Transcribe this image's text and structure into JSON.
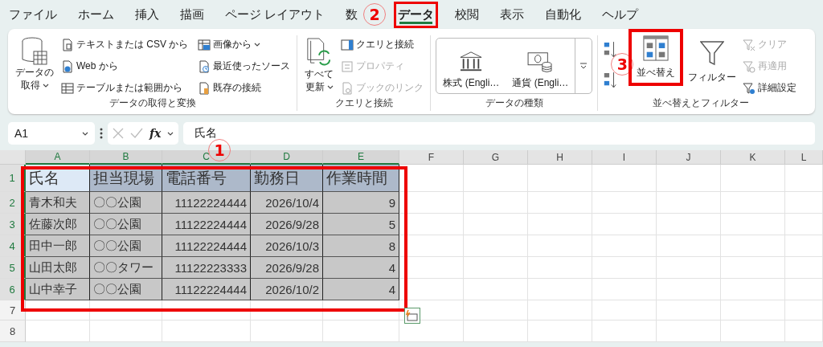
{
  "menu_tabs": [
    {
      "label": "ファイル",
      "selected": false,
      "highlighted": false
    },
    {
      "label": "ホーム",
      "selected": false,
      "highlighted": false
    },
    {
      "label": "挿入",
      "selected": false,
      "highlighted": false
    },
    {
      "label": "描画",
      "selected": false,
      "highlighted": false
    },
    {
      "label": "ページ レイアウト",
      "selected": false,
      "highlighted": false
    },
    {
      "label": "数",
      "selected": false,
      "highlighted": false
    },
    {
      "label": "データ",
      "selected": true,
      "highlighted": true
    },
    {
      "label": "校閲",
      "selected": false,
      "highlighted": false
    },
    {
      "label": "表示",
      "selected": false,
      "highlighted": false
    },
    {
      "label": "自動化",
      "selected": false,
      "highlighted": false
    },
    {
      "label": "ヘルプ",
      "selected": false,
      "highlighted": false
    }
  ],
  "ribbon": {
    "groups": [
      {
        "kind": "get_transform",
        "title": "データの取得と変換",
        "main_button": [
          "データの",
          "取得"
        ],
        "items": [
          {
            "label": "テキストまたは CSV から",
            "disabled": false
          },
          {
            "label": "Web から",
            "disabled": false
          },
          {
            "label": "テーブルまたは範囲から",
            "disabled": false
          },
          {
            "label": "画像から",
            "disabled": false
          },
          {
            "label": "最近使ったソース",
            "disabled": false
          },
          {
            "label": "既存の接続",
            "disabled": false
          }
        ]
      },
      {
        "kind": "queries",
        "title": "クエリと接続",
        "main_button": [
          "すべて",
          "更新"
        ],
        "items": [
          {
            "label": "クエリと接続",
            "disabled": false
          },
          {
            "label": "プロパティ",
            "disabled": true
          },
          {
            "label": "ブックのリンク",
            "disabled": true
          }
        ]
      },
      {
        "kind": "data_types",
        "title": "データの種類",
        "items": [
          {
            "label": "株式 (Engli…"
          },
          {
            "label": "通貨 (Engli…"
          }
        ]
      },
      {
        "kind": "sort_filter",
        "title": "並べ替えとフィルター",
        "sort_button": {
          "label": "並べ替え",
          "highlighted": true
        },
        "filter_button": {
          "label": "フィルター"
        },
        "items": [
          {
            "label": "クリア",
            "disabled": true
          },
          {
            "label": "再適用",
            "disabled": true
          },
          {
            "label": "詳細設定",
            "disabled": false
          }
        ]
      }
    ]
  },
  "formula_bar": {
    "name_box": "A1",
    "function_label": "fx",
    "value": "氏名"
  },
  "sheet": {
    "columns": [
      {
        "label": "A",
        "selected": true,
        "kind": "text"
      },
      {
        "label": "B",
        "selected": true,
        "kind": "text"
      },
      {
        "label": "C",
        "selected": true,
        "kind": "number"
      },
      {
        "label": "D",
        "selected": true,
        "kind": "number"
      },
      {
        "label": "E",
        "selected": true,
        "kind": "number"
      },
      {
        "label": "F",
        "selected": false,
        "kind": "text"
      },
      {
        "label": "G",
        "selected": false,
        "kind": "text"
      },
      {
        "label": "H",
        "selected": false,
        "kind": "text"
      },
      {
        "label": "I",
        "selected": false,
        "kind": "text"
      },
      {
        "label": "J",
        "selected": false,
        "kind": "text"
      },
      {
        "label": "K",
        "selected": false,
        "kind": "text"
      },
      {
        "label": "L",
        "selected": false,
        "kind": "text"
      }
    ],
    "rows": [
      {
        "number": "1",
        "selected": true,
        "kind": "header",
        "cells": [
          "氏名",
          "担当現場",
          "電話番号",
          "勤務日",
          "作業時間"
        ]
      },
      {
        "number": "2",
        "selected": true,
        "kind": "data",
        "cells": [
          "青木和夫",
          "〇〇公園",
          "11122224444",
          "2026/10/4",
          "9"
        ]
      },
      {
        "number": "3",
        "selected": true,
        "kind": "data",
        "cells": [
          "佐藤次郎",
          "〇〇公園",
          "11122224444",
          "2026/9/28",
          "5"
        ]
      },
      {
        "number": "4",
        "selected": true,
        "kind": "data",
        "cells": [
          "田中一郎",
          "〇〇公園",
          "11122224444",
          "2026/10/3",
          "8"
        ]
      },
      {
        "number": "5",
        "selected": true,
        "kind": "data",
        "cells": [
          "山田太郎",
          "〇〇タワー",
          "11122223333",
          "2026/9/28",
          "4"
        ]
      },
      {
        "number": "6",
        "selected": true,
        "kind": "data",
        "cells": [
          "山中幸子",
          "〇〇公園",
          "11122224444",
          "2026/10/2",
          "4"
        ]
      },
      {
        "number": "7",
        "selected": false,
        "kind": "empty",
        "cells": []
      },
      {
        "number": "8",
        "selected": false,
        "kind": "empty",
        "cells": []
      }
    ]
  },
  "annotations": [
    {
      "label": "1"
    },
    {
      "label": "2"
    },
    {
      "label": "3"
    }
  ]
}
